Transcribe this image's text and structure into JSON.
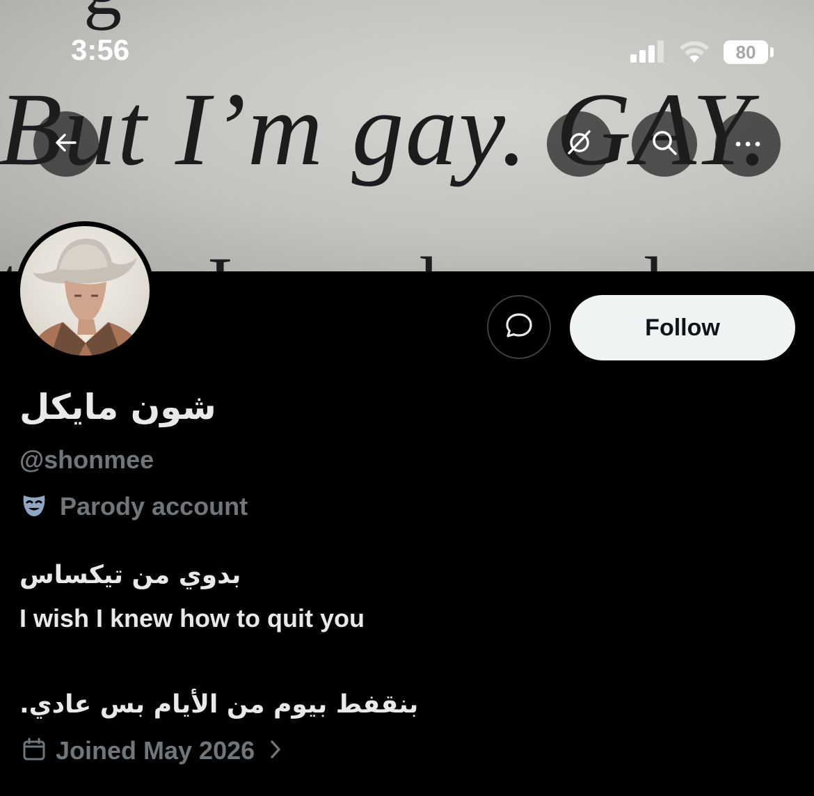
{
  "status_bar": {
    "time": "3:56",
    "battery": "80"
  },
  "banner": {
    "text": "But I’m gay. GAY.",
    "stub_top": "g",
    "stub_bottom": "t I k  l  C"
  },
  "header_actions": {
    "back_icon": "arrow-left-icon",
    "grok_icon": "grok-icon",
    "search_icon": "search-icon",
    "more_icon": "more-icon"
  },
  "profile": {
    "display_name": "شون مايكل",
    "handle": "@shonmee",
    "parody_label": "Parody account",
    "bio_lines": [
      "بدوي من تيكساس",
      "I wish I knew how to quit you",
      "",
      "بنقفط بيوم من الأيام بس عادي."
    ],
    "joined": "Joined May 2026"
  },
  "actions": {
    "message_icon": "message-icon",
    "follow_label": "Follow"
  },
  "colors": {
    "background": "#000000",
    "primary_text": "#e7e9ea",
    "secondary_text": "#71767b",
    "follow_bg": "#eff3f4",
    "parody_icon": "#8ea8c4"
  }
}
